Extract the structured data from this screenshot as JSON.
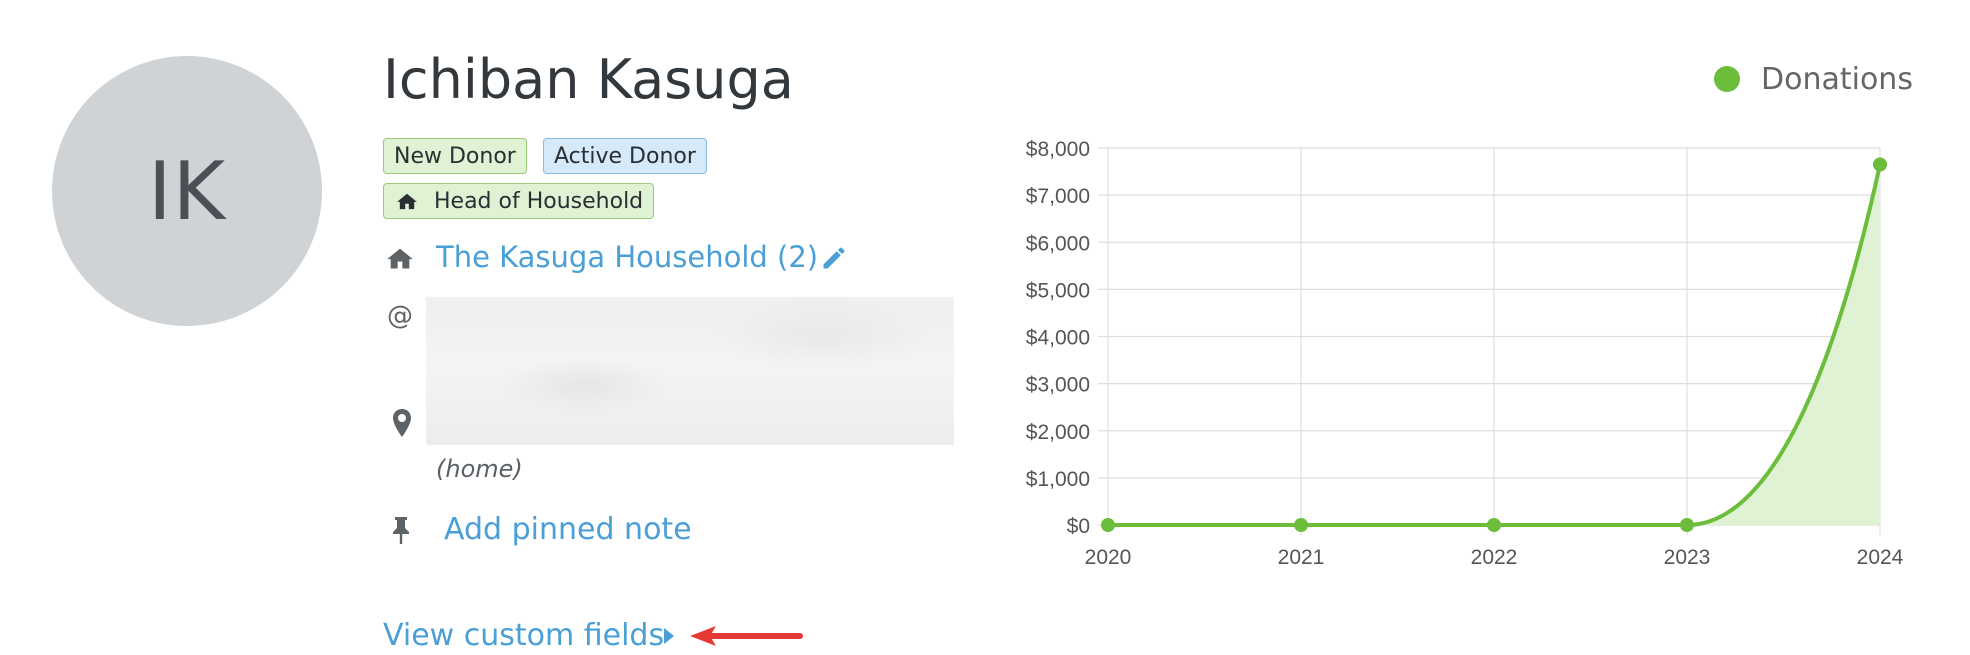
{
  "profile": {
    "initials": "IK",
    "name": "Ichiban Kasuga",
    "badges": {
      "new_donor": "New Donor",
      "active_donor": "Active Donor",
      "head_of_household": "Head of Household"
    },
    "household_link": "The Kasuga Household (2)",
    "address_type": "(home)",
    "add_pinned_note": "Add pinned note",
    "view_custom_fields": "View custom fields"
  },
  "icons": {
    "household": "home-icon",
    "edit": "pencil-icon",
    "email": "at-icon",
    "address": "map-marker-icon",
    "pinned_note": "pin-icon",
    "expand": "caret-right-icon",
    "annotation": "red-arrow-icon"
  },
  "colors": {
    "link": "#4a9fd6",
    "series": "#6cbd3b",
    "series_fill": "#dff2d4",
    "annotation_arrow": "#e53935"
  },
  "chart_data": {
    "type": "area",
    "x": [
      "2020",
      "2021",
      "2022",
      "2023",
      "2024"
    ],
    "series": [
      {
        "name": "Donations",
        "values": [
          0,
          0,
          0,
          0,
          7650
        ]
      }
    ],
    "y_ticks": [
      "$0",
      "$1,000",
      "$2,000",
      "$3,000",
      "$4,000",
      "$5,000",
      "$6,000",
      "$7,000",
      "$8,000"
    ],
    "ylim": [
      0,
      8000
    ],
    "grid": true,
    "legend": "top-right"
  }
}
